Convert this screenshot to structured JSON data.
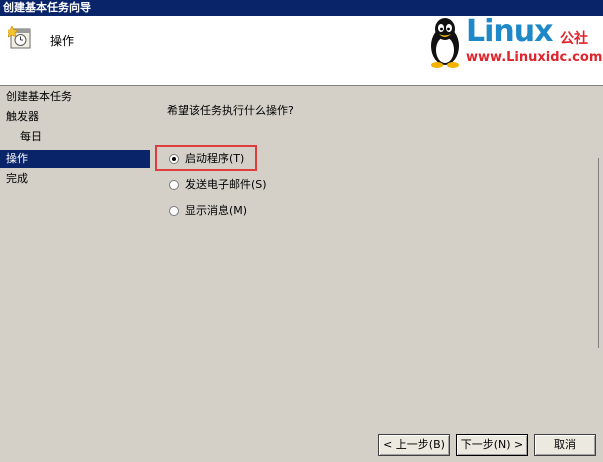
{
  "window": {
    "title": "创建基本任务向导"
  },
  "header": {
    "title": "操作",
    "icon": "task-clock-icon"
  },
  "watermark": {
    "brand": "Linux",
    "suffix": "公社",
    "url": "www.Linuxidc.com",
    "colors": {
      "brand": "#1e88c8",
      "accent": "#e0242b"
    }
  },
  "sidebar": {
    "items": [
      {
        "label": "创建基本任务",
        "sub": false,
        "active": false
      },
      {
        "label": "触发器",
        "sub": false,
        "active": false
      },
      {
        "label": "每日",
        "sub": true,
        "active": false
      },
      {
        "label": "操作",
        "sub": false,
        "active": true
      },
      {
        "label": "完成",
        "sub": false,
        "active": false
      }
    ]
  },
  "content": {
    "question": "希望该任务执行什么操作?",
    "options": [
      {
        "label": "启动程序(T)",
        "checked": true
      },
      {
        "label": "发送电子邮件(S)",
        "checked": false
      },
      {
        "label": "显示消息(M)",
        "checked": false
      }
    ]
  },
  "buttons": {
    "back": "< 上一步(B)",
    "next": "下一步(N) >",
    "cancel": "取消"
  },
  "colors": {
    "selection": "#0a246a",
    "annotation": "#e03c3c"
  }
}
